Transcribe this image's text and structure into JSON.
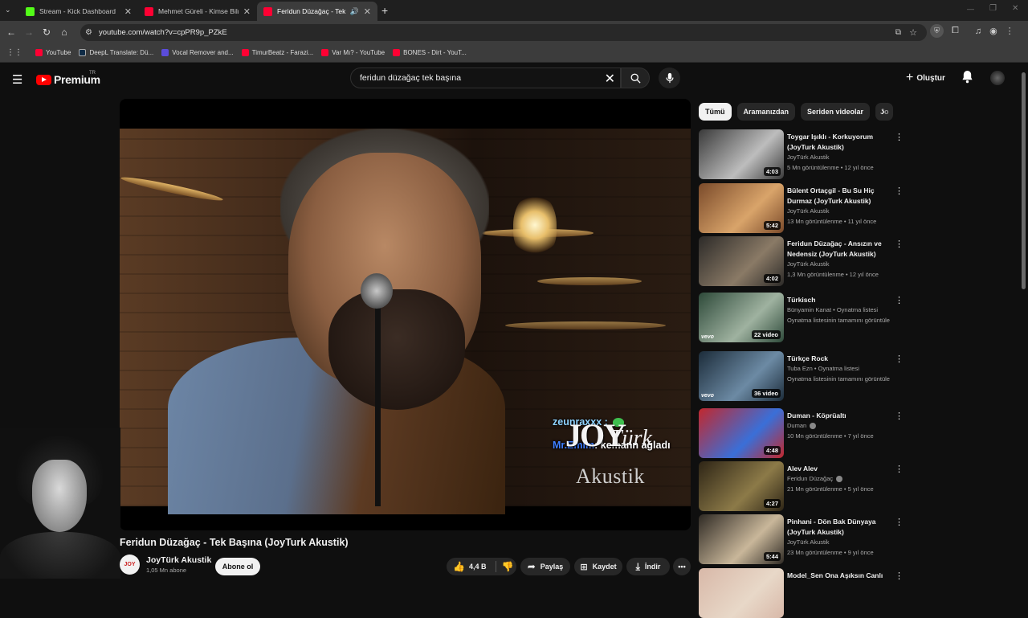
{
  "browser": {
    "tabs": [
      {
        "title": "Stream - Kick Dashboard",
        "favicon_color": "#53fc18"
      },
      {
        "title": "Mehmet Güreli - Kimse Bilmez",
        "favicon_color": "#ff0033"
      },
      {
        "title": "Feridun Düzağaç - Tek Başı",
        "favicon_color": "#ff0033"
      }
    ],
    "url": "youtube.com/watch?v=cpPR9p_PZkE",
    "bookmarks": [
      {
        "label": "YouTube",
        "color": "#ff0033"
      },
      {
        "label": "DeepL Translate: Dü...",
        "color": "#0f2b46"
      },
      {
        "label": "Vocal Remover and...",
        "color": "#5b4cdb"
      },
      {
        "label": "TimurBeatz - Farazi...",
        "color": "#ff0033"
      },
      {
        "label": "Var Mı? - YouTube",
        "color": "#ff0033"
      },
      {
        "label": "BONES - Dirt - YouT...",
        "color": "#ff0033"
      }
    ]
  },
  "youtube": {
    "logo_text": "Premium",
    "logo_sup": "TR",
    "search_value": "feridun düzağaç tek başına",
    "create_label": "Oluştur"
  },
  "player": {
    "chat_user1": "zeunraxxx :",
    "chat_user2": "Mr.Emim",
    "chat_msg2": ": kemann ağladı",
    "logo_joy": "JOY",
    "logo_turk": "Türk",
    "logo_akustik": "Akustik"
  },
  "video": {
    "title": "Feridun Düzağaç - Tek Başına (JoyTurk Akustik)",
    "channel": "JoyTürk Akustik",
    "subscribers": "1,05 Mn abone",
    "subscribe_label": "Abone ol",
    "likes": "4,4 B",
    "share_label": "Paylaş",
    "save_label": "Kaydet",
    "download_label": "İndir"
  },
  "chips": [
    "Tümü",
    "Aramanızdan",
    "Seriden videolar",
    "Jo"
  ],
  "recommendations": [
    {
      "title": "Toygar Işıklı - Korkuyorum (JoyTurk Akustik)",
      "channel": "JoyTürk Akustik",
      "meta": "5 Mn görüntülenme • 12 yıl önce",
      "duration": "4:03",
      "colors": [
        "#3a3a3a",
        "#bdbdbd"
      ]
    },
    {
      "title": "Bülent Ortaçgil - Bu Su Hiç Durmaz (JoyTurk Akustik)",
      "channel": "JoyTürk Akustik",
      "meta": "13 Mn görüntülenme • 11 yıl önce",
      "duration": "5:42",
      "colors": [
        "#7a4a2a",
        "#d9a46a"
      ]
    },
    {
      "title": "Feridun Düzağaç - Ansızın ve Nedensiz (JoyTurk Akustik)",
      "channel": "JoyTürk Akustik",
      "meta": "1,3 Mn görüntülenme • 12 yıl önce",
      "duration": "4:02",
      "colors": [
        "#2c2a28",
        "#8a7a66"
      ]
    },
    {
      "title": "Türkisch",
      "channel": "Bünyamin Kanat • Oynatma listesi",
      "meta": "Oynatma listesinin tamamını görüntüle",
      "duration": "22 video",
      "colors": [
        "#2e4a3a",
        "#9fb2a0"
      ],
      "vevo": "vevo"
    },
    {
      "title": "Türkçe Rock",
      "channel": "Tuba Ezn • Oynatma listesi",
      "meta": "Oynatma listesinin tamamını görüntüle",
      "duration": "36 video",
      "colors": [
        "#1c2c3a",
        "#6c8aa4"
      ],
      "vevo": "vevo"
    },
    {
      "title": "Duman - Köprüaltı",
      "channel": "Duman",
      "meta": "10 Mn görüntülenme • 7 yıl önce",
      "duration": "4:48",
      "colors": [
        "#c2272d",
        "#3a6fd8"
      ],
      "verified": true
    },
    {
      "title": "Alev Alev",
      "channel": "Feridun Düzağaç",
      "meta": "21 Mn görüntülenme • 5 yıl önce",
      "duration": "4:27",
      "colors": [
        "#2e2516",
        "#8c7a48"
      ],
      "verified": true
    },
    {
      "title": "Pinhani - Dön Bak Dünyaya (JoyTurk Akustik)",
      "channel": "JoyTürk Akustik",
      "meta": "23 Mn görüntülenme • 9 yıl önce",
      "duration": "5:44",
      "colors": [
        "#2f2a24",
        "#c9b79a"
      ]
    },
    {
      "title": "Model_Sen Ona Aşıksın Canlı",
      "channel": "",
      "meta": "",
      "duration": "",
      "colors": [
        "#d8b8a8",
        "#e8d8c8"
      ]
    }
  ]
}
